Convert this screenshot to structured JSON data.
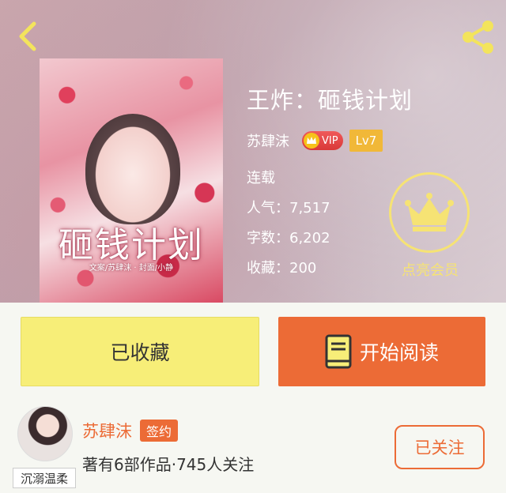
{
  "header": {
    "back_icon": "chevron-left-icon",
    "share_icon": "share-icon",
    "icon_color": "#f3e45c"
  },
  "book": {
    "cover_title": "砸钱计划",
    "cover_credit": "文案/苏肆沫 · 封面/小静",
    "title": "王炸：砸钱计划",
    "author": "苏肆沫",
    "vip_label": "VIP",
    "level_label": "Lv7",
    "status": "连载",
    "popularity": "人气：7,517",
    "word_count": "字数：6,202",
    "favorites": "收藏：200"
  },
  "member": {
    "icon": "crown-icon",
    "label": "点亮会员",
    "color": "#f6e374"
  },
  "actions": {
    "collected_label": "已收藏",
    "read_label": "开始阅读",
    "read_icon": "book-icon",
    "collected_color": "#f7ee78",
    "read_color": "#ec6b36"
  },
  "author_card": {
    "avatar_caption": "沉溺温柔",
    "name": "苏肆沫",
    "signed_label": "签约",
    "description": "著有6部作品·745人关注",
    "follow_label": "已关注"
  }
}
